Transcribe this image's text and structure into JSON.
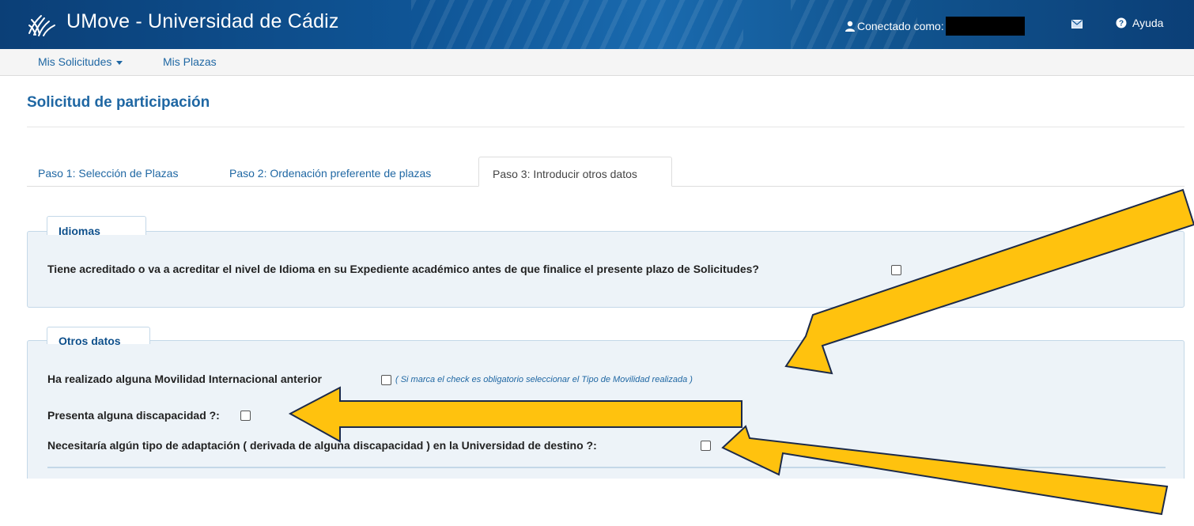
{
  "header": {
    "app_title": "UMove - Universidad de Cádiz",
    "connected_label": "Conectado como:",
    "help_label": "Ayuda",
    "logo_icon": "university-logo-icon",
    "user_icon": "user-icon",
    "mail_icon": "envelope-icon",
    "help_icon": "question-circle-icon"
  },
  "nav": {
    "items": [
      {
        "label": "Mis Solicitudes",
        "dropdown": true
      },
      {
        "label": "Mis Plazas",
        "dropdown": false
      }
    ]
  },
  "page": {
    "title": "Solicitud de participación"
  },
  "tabs": [
    {
      "label": "Paso 1: Selección de Plazas",
      "active": false
    },
    {
      "label": "Paso 2: Ordenación preferente de plazas",
      "active": false
    },
    {
      "label": "Paso 3: Introducir otros datos",
      "active": true
    }
  ],
  "sections": {
    "idiomas": {
      "legend": "Idiomas",
      "question": "Tiene acreditado o va a acreditar el nivel de Idioma en su Expediente académico antes de que finalice el presente plazo de Solicitudes?",
      "checked": false
    },
    "otros_datos": {
      "legend": "Otros datos",
      "movilidad": {
        "question": "Ha realizado alguna Movilidad Internacional anterior",
        "hint": "( Si marca el check es obligatorio seleccionar el Tipo de Movilidad realizada )",
        "checked": false
      },
      "discapacidad": {
        "question": "Presenta alguna discapacidad ?:",
        "checked": false
      },
      "adaptacion": {
        "question": "Necesitaría algún tipo de adaptación ( derivada de alguna discapacidad ) en la Universidad de destino ?:",
        "checked": false
      }
    }
  },
  "colors": {
    "header_bg": "#0f5596",
    "link": "#1f67a3",
    "panel_bg": "#edf3f8",
    "arrow_fill": "#ffc20e"
  }
}
